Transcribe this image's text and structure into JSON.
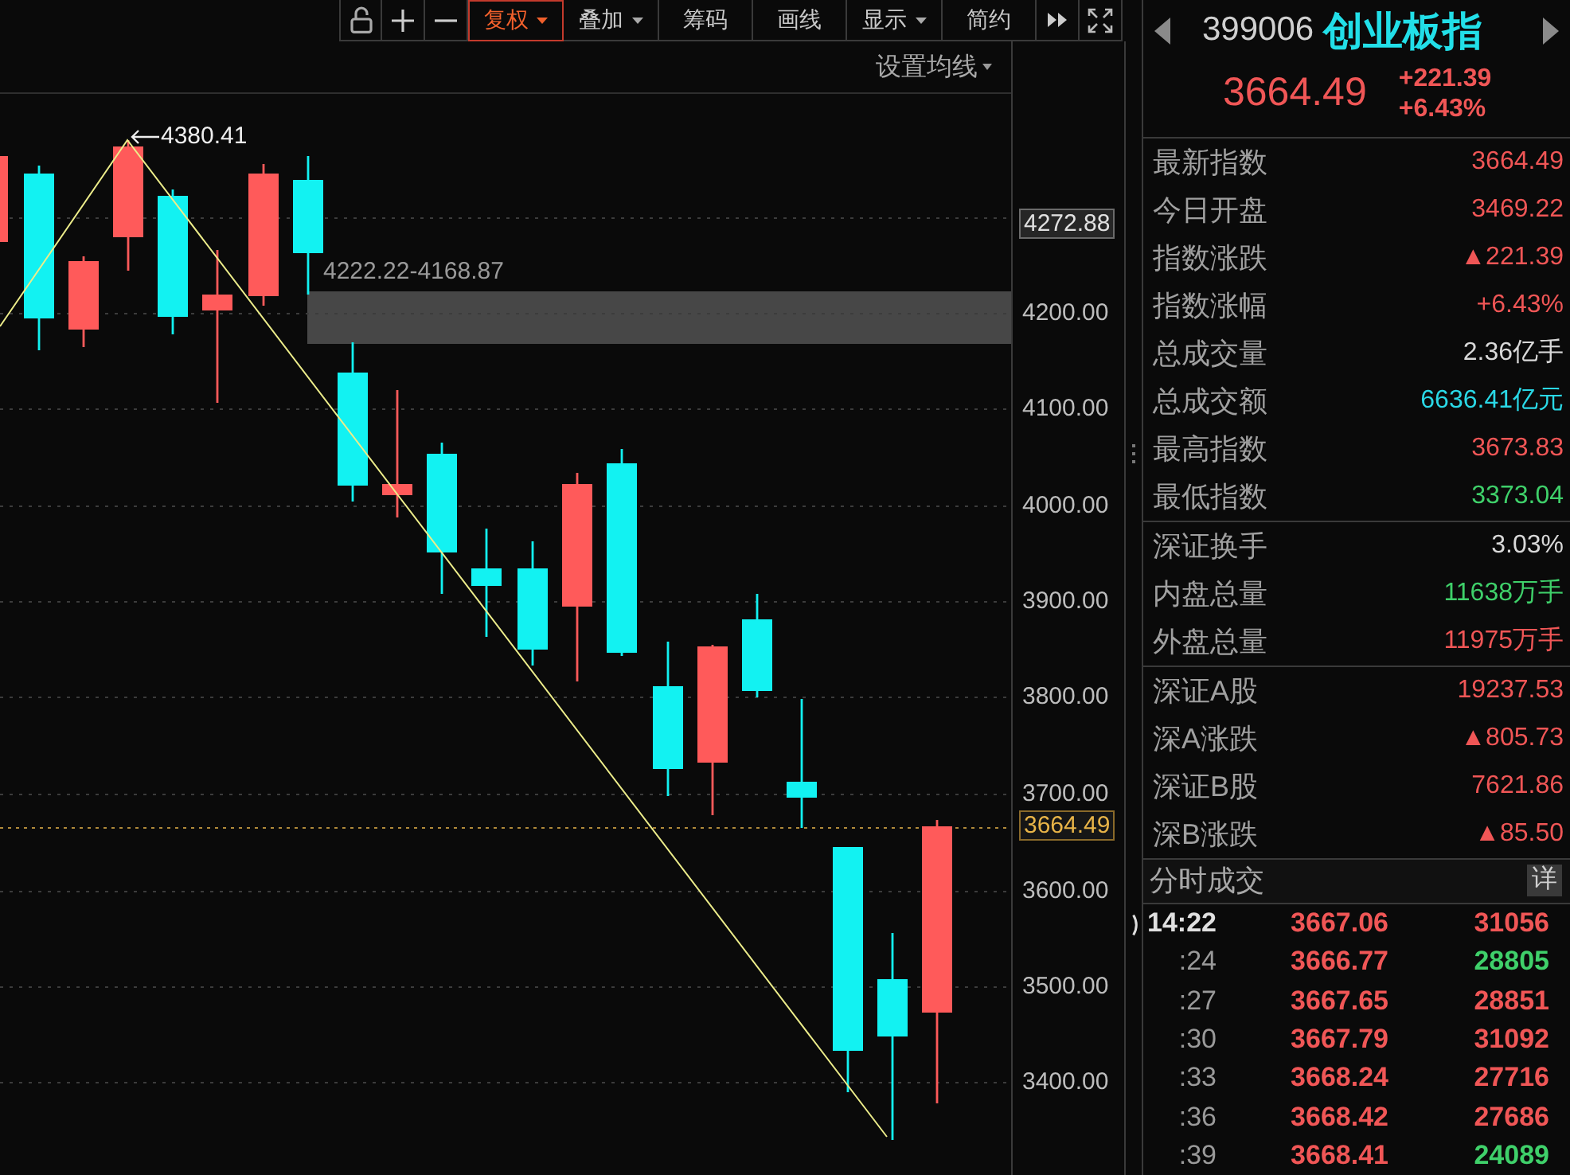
{
  "toolbar": {
    "buttons": [
      {
        "label": "复权",
        "dropdown": true,
        "selected": true
      },
      {
        "label": "叠加",
        "dropdown": true,
        "selected": false
      },
      {
        "label": "筹码",
        "dropdown": false,
        "selected": false
      },
      {
        "label": "画线",
        "dropdown": false,
        "selected": false
      },
      {
        "label": "显示",
        "dropdown": true,
        "selected": false
      },
      {
        "label": "简约",
        "dropdown": false,
        "selected": false
      }
    ]
  },
  "chart": {
    "ma_setting": "设置均线",
    "peak_label": "4380.41",
    "range_label": "4222.22-4168.87",
    "axis_labels": [
      {
        "text": "4272.88",
        "kind": "high"
      },
      {
        "text": "4200.00",
        "kind": "tick"
      },
      {
        "text": "4100.00",
        "kind": "tick"
      },
      {
        "text": "4000.00",
        "kind": "tick"
      },
      {
        "text": "3900.00",
        "kind": "tick"
      },
      {
        "text": "3800.00",
        "kind": "tick"
      },
      {
        "text": "3700.00",
        "kind": "tick"
      },
      {
        "text": "3664.49",
        "kind": "last"
      },
      {
        "text": "3600.00",
        "kind": "tick"
      },
      {
        "text": "3500.00",
        "kind": "tick"
      },
      {
        "text": "3400.00",
        "kind": "tick"
      }
    ],
    "candles": [
      {
        "kind": "rise"
      },
      {
        "kind": "fall"
      },
      {
        "kind": "rise"
      },
      {
        "kind": "rise"
      },
      {
        "kind": "fall"
      },
      {
        "kind": "rise"
      },
      {
        "kind": "rise"
      },
      {
        "kind": "fall"
      },
      {
        "kind": "fall"
      },
      {
        "kind": "rise"
      },
      {
        "kind": "fall"
      },
      {
        "kind": "fall"
      },
      {
        "kind": "fall"
      },
      {
        "kind": "rise"
      },
      {
        "kind": "fall"
      },
      {
        "kind": "fall"
      },
      {
        "kind": "rise"
      },
      {
        "kind": "fall"
      },
      {
        "kind": "fall"
      },
      {
        "kind": "fall"
      },
      {
        "kind": "fall"
      },
      {
        "kind": "rise"
      }
    ]
  },
  "quote": {
    "code": "399006",
    "name": "创业板指",
    "price": "3664.49",
    "change": "+221.39",
    "change_percent": "+6.43%"
  },
  "stats": [
    {
      "rows": [
        {
          "label": "最新指数",
          "value": "3664.49",
          "color": "#f05656"
        },
        {
          "label": "今日开盘",
          "value": "3469.22",
          "color": "#f05656"
        },
        {
          "label": "指数涨跌",
          "value": "▲221.39",
          "color": "#f05656"
        },
        {
          "label": "指数涨幅",
          "value": "+6.43%",
          "color": "#f05656"
        },
        {
          "label": "总成交量",
          "value": "2.36亿手",
          "color": "#d8d8d8"
        },
        {
          "label": "总成交额",
          "value": "6636.41亿元",
          "color": "#2ad8e6"
        },
        {
          "label": "最高指数",
          "value": "3673.83",
          "color": "#f05656"
        },
        {
          "label": "最低指数",
          "value": "3373.04",
          "color": "#3fd06a"
        }
      ]
    },
    {
      "rows": [
        {
          "label": "深证换手",
          "value": "3.03%",
          "color": "#d8d8d8"
        },
        {
          "label": "内盘总量",
          "value": "11638万手",
          "color": "#3fd06a"
        },
        {
          "label": "外盘总量",
          "value": "11975万手",
          "color": "#f05656"
        }
      ]
    },
    {
      "rows": [
        {
          "label": "深证A股",
          "value": "19237.53",
          "color": "#f05656"
        },
        {
          "label": "深A涨跌",
          "value": "▲805.73",
          "color": "#f05656"
        },
        {
          "label": "深证B股",
          "value": "7621.86",
          "color": "#f05656"
        },
        {
          "label": "深B涨跌",
          "value": "▲85.50",
          "color": "#f05656"
        }
      ]
    }
  ],
  "ticks": {
    "title": "分时成交",
    "detail_button": "详",
    "rows": [
      {
        "time": "14:22",
        "kind": "full",
        "price": "3667.06",
        "volume": "31056",
        "color": "#f05656"
      },
      {
        "time": ":24",
        "kind": "minute",
        "price": "3666.77",
        "volume": "28805",
        "color": "#3fd06a"
      },
      {
        "time": ":27",
        "kind": "minute",
        "price": "3667.65",
        "volume": "28851",
        "color": "#f05656"
      },
      {
        "time": ":30",
        "kind": "minute",
        "price": "3667.79",
        "volume": "31092",
        "color": "#f05656"
      },
      {
        "time": ":33",
        "kind": "minute",
        "price": "3668.24",
        "volume": "27716",
        "color": "#f05656"
      },
      {
        "time": ":36",
        "kind": "minute",
        "price": "3668.42",
        "volume": "27686",
        "color": "#f05656"
      },
      {
        "time": ":39",
        "kind": "minute",
        "price": "3668.41",
        "volume": "24089",
        "color": "#3fd06a"
      }
    ]
  }
}
